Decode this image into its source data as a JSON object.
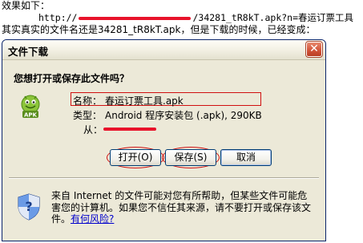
{
  "intro": {
    "line1": "效果如下：",
    "line2_prefix": "http://",
    "line2_suffix": "/34281_tR8kT.apk?n=春运订票工具",
    "line3": "其实真实的文件名还是34281_tR8kT.apk，但是下载的时候，已经变成："
  },
  "dialog": {
    "title": "文件下载",
    "close_glyph": "✕",
    "question": "您想打开或保存此文件吗？",
    "icon": "android-apk-icon",
    "file_info": {
      "name_label": "名称：",
      "name_value": "春运订票工具.apk",
      "type_label": "类型：",
      "type_value": "Android  程序安装包 (.apk), 290KB",
      "from_label": "从："
    },
    "buttons": {
      "open": "打开(O)",
      "save": "保存(S)",
      "cancel": "取消"
    },
    "warning": {
      "text": "来自 Internet 的文件可能对您有所帮助，但某些文件可能危害您的计算机。如果您不信任其来源，请不要打开或保存该文件。",
      "link": "有何风险?"
    }
  },
  "colors": {
    "redaction": "#e8132b",
    "annotation": "#d01010",
    "dialog_bg": "#ece9d8",
    "link": "#0000cc"
  }
}
